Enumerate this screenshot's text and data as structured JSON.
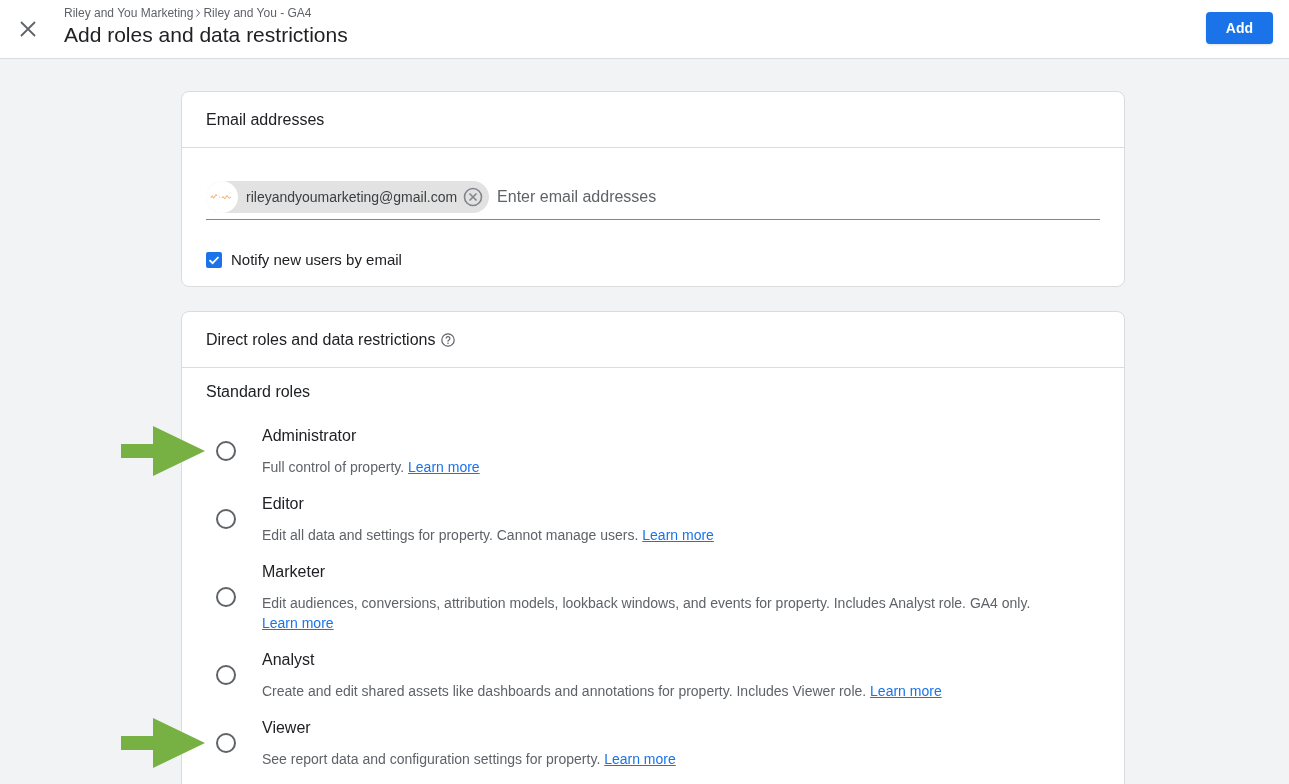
{
  "header": {
    "breadcrumbs": [
      "Riley and You Marketing",
      "Riley and You - GA4"
    ],
    "title": "Add roles and data restrictions",
    "primary_button": "Add"
  },
  "email_card": {
    "title": "Email addresses",
    "chips": [
      {
        "email": "rileyandyoumarketing@gmail.com"
      }
    ],
    "input": {
      "placeholder": "Enter email addresses"
    },
    "notify": {
      "label": "Notify new users by email",
      "checked": true
    }
  },
  "roles_card": {
    "title": "Direct roles and data restrictions",
    "section_title": "Standard roles",
    "roles": [
      {
        "name": "Administrator",
        "description": "Full control of property.",
        "link": "Learn more",
        "selected": false,
        "annotation_arrow": true
      },
      {
        "name": "Editor",
        "description": "Edit all data and settings for property. Cannot manage users.",
        "link": "Learn more",
        "selected": false,
        "annotation_arrow": false
      },
      {
        "name": "Marketer",
        "description": "Edit audiences, conversions, attribution models, lookback windows, and events for property. Includes Analyst role. GA4 only.",
        "link": "Learn more",
        "selected": false,
        "annotation_arrow": false
      },
      {
        "name": "Analyst",
        "description": "Create and edit shared assets like dashboards and annotations for property. Includes Viewer role.",
        "link": "Learn more",
        "selected": false,
        "annotation_arrow": false
      },
      {
        "name": "Viewer",
        "description": "See report data and configuration settings for property.",
        "link": "Learn more",
        "selected": false,
        "annotation_arrow": true
      }
    ]
  }
}
